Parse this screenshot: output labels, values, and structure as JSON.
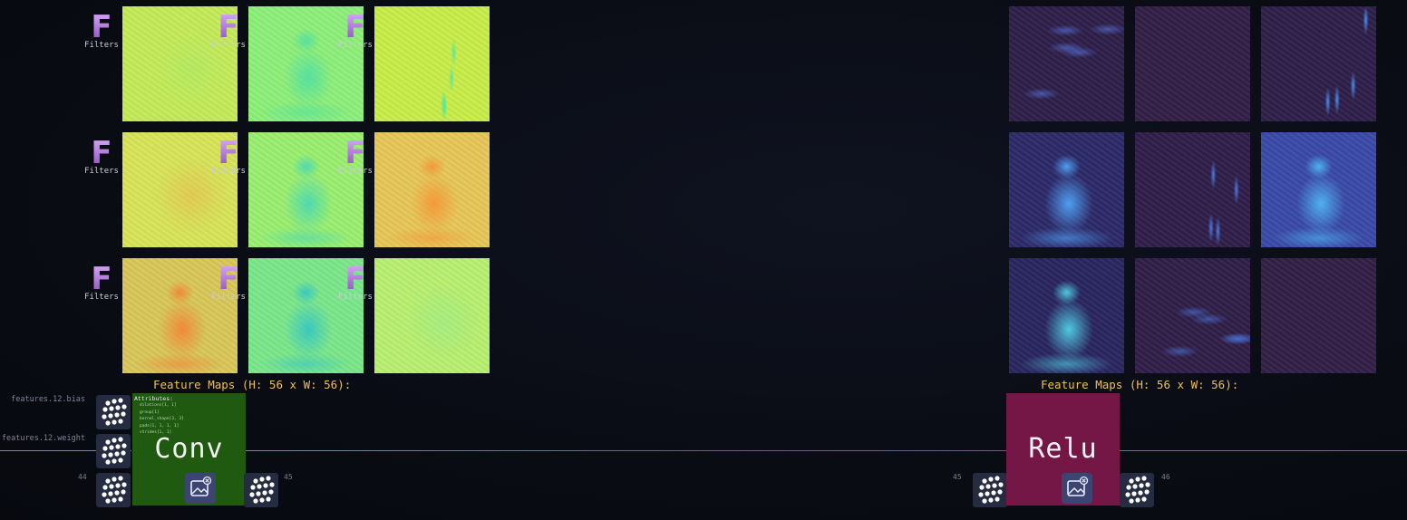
{
  "left_layer": {
    "filters_label": "Filters",
    "filter_letter": "F",
    "feature_maps_title": "Feature Maps (H: 56 x W: 56):",
    "param_labels": [
      "features.12.bias",
      "features.12.weight"
    ],
    "input_index": "44",
    "output_index": "45",
    "node": {
      "name": "Conv",
      "color": "#1f5a10",
      "attributes_title": "Attributes:",
      "attributes": [
        "dilations[1, 1]",
        "group[1]",
        "kernel_shape[3, 3]",
        "pads[1, 1, 1, 1]",
        "strides[1, 1]"
      ]
    },
    "maps": [
      {
        "base": "#c6ec5a",
        "tint": "#9ce86a",
        "style": "flat"
      },
      {
        "base": "#8ef07a",
        "tint": "#55e0a0",
        "style": "cat"
      },
      {
        "base": "#c9ee4a",
        "tint": "#5ce698",
        "style": "streak"
      },
      {
        "base": "#d8e55a",
        "tint": "#f2a64a",
        "style": "flat"
      },
      {
        "base": "#9af070",
        "tint": "#4fd9b0",
        "style": "cat"
      },
      {
        "base": "#e8c85a",
        "tint": "#f29a3a",
        "style": "cat"
      },
      {
        "base": "#d9c85a",
        "tint": "#f08a3a",
        "style": "cat"
      },
      {
        "base": "#7ce88a",
        "tint": "#3bc8c0",
        "style": "cat"
      },
      {
        "base": "#b9f070",
        "tint": "#8eea9a",
        "style": "flat"
      }
    ]
  },
  "right_layer": {
    "feature_maps_title": "Feature Maps (H: 56 x W: 56):",
    "input_index": "45",
    "output_index": "46",
    "node": {
      "name": "Relu",
      "color": "#741646"
    },
    "maps": [
      {
        "base": "#2e1f4a",
        "tint": "#5a7ae8",
        "style": "sparse"
      },
      {
        "base": "#331f48",
        "tint": "#331f48",
        "style": "empty"
      },
      {
        "base": "#2e1f4a",
        "tint": "#4a8ef0",
        "style": "streak"
      },
      {
        "base": "#2d2a6a",
        "tint": "#4f9ef0",
        "style": "cat"
      },
      {
        "base": "#301f4a",
        "tint": "#4a7ae8",
        "style": "streak"
      },
      {
        "base": "#3a4aa8",
        "tint": "#4fb0f0",
        "style": "cat"
      },
      {
        "base": "#2a2560",
        "tint": "#4fc8e0",
        "style": "cat"
      },
      {
        "base": "#301f48",
        "tint": "#4a7ae8",
        "style": "sparse"
      },
      {
        "base": "#331f48",
        "tint": "#331f48",
        "style": "empty"
      }
    ]
  },
  "colors": {
    "line_left": "#3aa0c8",
    "line_right": "#9a4a7a",
    "feature_title": "#f0c050"
  },
  "icons": {
    "param": "dots-grid-icon",
    "image": "image-icon",
    "filter": "filter-icon"
  }
}
